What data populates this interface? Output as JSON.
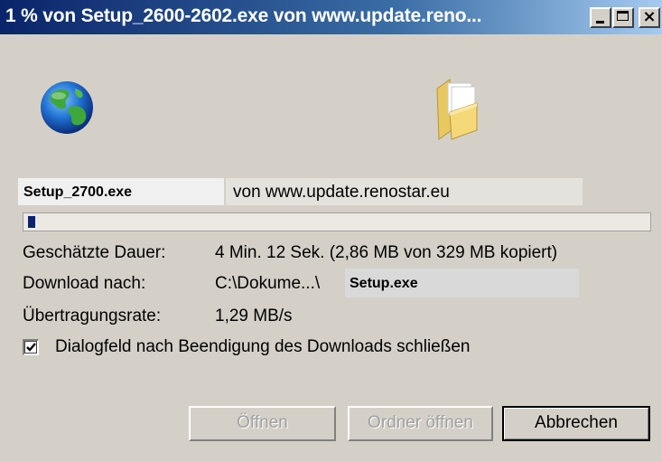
{
  "window": {
    "title": "1 % von Setup_2600-2602.exe von www.update.reno...",
    "minimize_label": "",
    "maximize_label": "",
    "close_label": "×"
  },
  "icons": {
    "source": "globe-icon",
    "destination": "folder-icon"
  },
  "download": {
    "filename": "Setup_2700.exe",
    "source": "von www.update.renostar.eu",
    "progress_fraction": 0.01
  },
  "info": {
    "duration_label": "Geschätzte Dauer:",
    "duration_value": "4 Min. 12 Sek. (2,86 MB von 329 MB kopiert)",
    "target_label": "Download nach:",
    "target_path": "C:\\Dokume...\\",
    "target_file": "Setup.exe",
    "rate_label": "Übertragungsrate:",
    "rate_value": "1,29 MB/s"
  },
  "close_on_finish": {
    "label": "Dialogfeld nach Beendigung des Downloads schließen",
    "checked": true
  },
  "buttons": {
    "open": "Öffnen",
    "open_folder": "Ordner öffnen",
    "cancel": "Abbrechen"
  },
  "colors": {
    "titlebar_start": "#0a246a",
    "progress_fill": "#0a246a",
    "face": "#d4d0c8"
  }
}
